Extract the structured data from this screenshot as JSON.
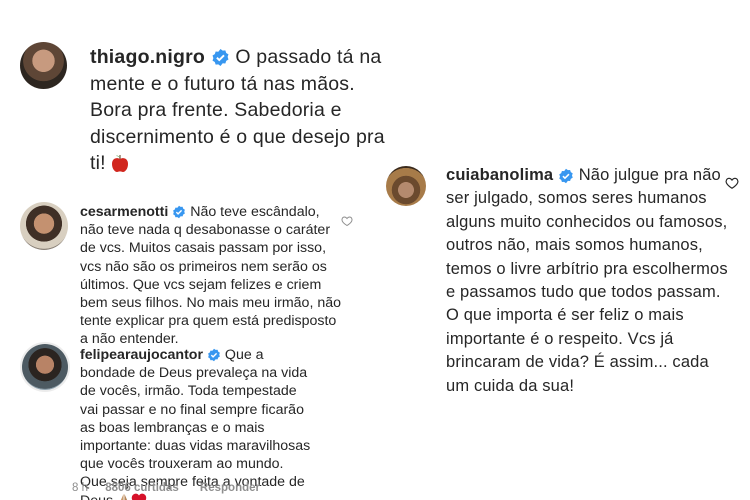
{
  "comments": [
    {
      "username": "thiago.nigro",
      "text": "O passado tá na mente e o futuro tá nas mãos. Bora pra frente. Sabedoria e discernimento é o que desejo pra ti!"
    },
    {
      "username": "cuiabanolima",
      "text": "Não julgue pra não ser julgado, somos seres humanos alguns muito conhecidos ou famosos, outros não, mais somos humanos, temos o livre arbítrio pra escolhermos e passamos tudo que todos passam. O que importa é ser feliz o mais importante é o respeito. Vcs já brincaram de vida? É assim... cada um cuida da sua!"
    },
    {
      "username": "cesarmenotti",
      "text": "Não teve escândalo, não teve nada q desabonasse o caráter de vcs. Muitos casais passam por isso, vcs não são os primeiros nem serão os últimos. Que vcs sejam felizes e criem bem seus filhos. No mais meu irmão, não tente explicar pra quem está predisposto a não entender."
    },
    {
      "username": "felipearaujocantor",
      "text": "Que a bondade de Deus prevaleça na vida de vocês, irmão. Toda tempestade vai passar e no final sempre ficarão as boas lembranças e o mais importante: duas vidas maravilhosas que vocês trouxeram ao mundo. Que seja sempre feita a vontade de Deus",
      "time": "8 h",
      "likes": "8806 curtidas",
      "reply": "Responder"
    }
  ],
  "colors": {
    "text": "#262626",
    "verified": "#3897f0",
    "meta": "#8e8e8e"
  },
  "icons": [
    "verified-badge-icon",
    "apple-emoji-icon",
    "praying-hands-emoji-icon",
    "red-heart-emoji-icon",
    "heart-outline-icon"
  ]
}
